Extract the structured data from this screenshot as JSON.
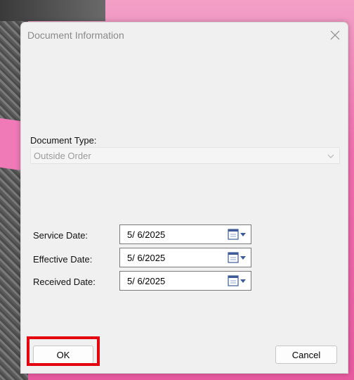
{
  "dialog": {
    "title": "Document Information",
    "close_icon": "close-icon"
  },
  "document_type": {
    "label": "Document Type:",
    "value": "Outside Order"
  },
  "dates": [
    {
      "label": "Service Date:",
      "value": "5/ 6/2025"
    },
    {
      "label": "Effective Date:",
      "value": "5/ 6/2025"
    },
    {
      "label": "Received Date:",
      "value": "5/ 6/2025"
    }
  ],
  "buttons": {
    "ok": "OK",
    "cancel": "Cancel"
  },
  "colors": {
    "highlight": "#e3000f",
    "calendar_icon": "#3d5a99"
  }
}
